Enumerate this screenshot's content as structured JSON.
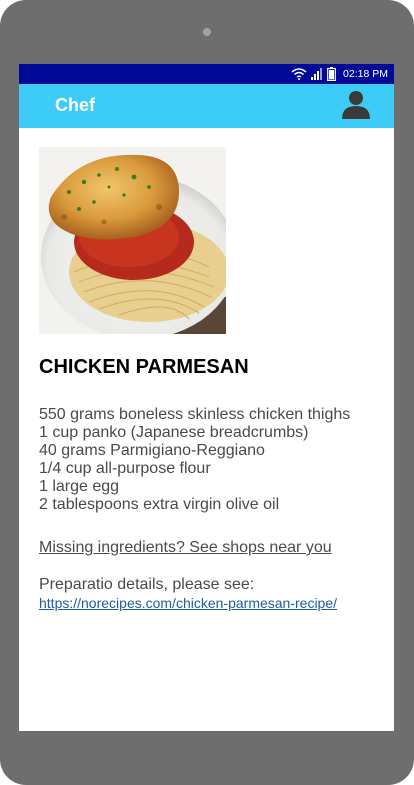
{
  "status_bar": {
    "time": "02:18 PM",
    "icons": [
      "wifi-icon",
      "signal-icon",
      "battery-icon"
    ],
    "background": "#000a96"
  },
  "app_bar": {
    "title": "Chef",
    "background": "#3dcbf8",
    "profile_icon": "user-icon"
  },
  "recipe": {
    "title": "CHICKEN PARMESAN",
    "image": "chicken-parmesan-photo",
    "ingredients": [
      "550 grams boneless skinless chicken thighs",
      "1 cup panko (Japanese breadcrumbs)",
      "40 grams Parmigiano-Reggiano",
      "1/4 cup all-purpose flour",
      "1 large egg",
      "2 tablespoons extra virgin olive oil"
    ],
    "shops_link": "Missing ingredients? See shops near you",
    "preparation_label": "Preparatio details, please see:",
    "preparation_url": "https://norecipes.com/chicken-parmesan-recipe/"
  }
}
